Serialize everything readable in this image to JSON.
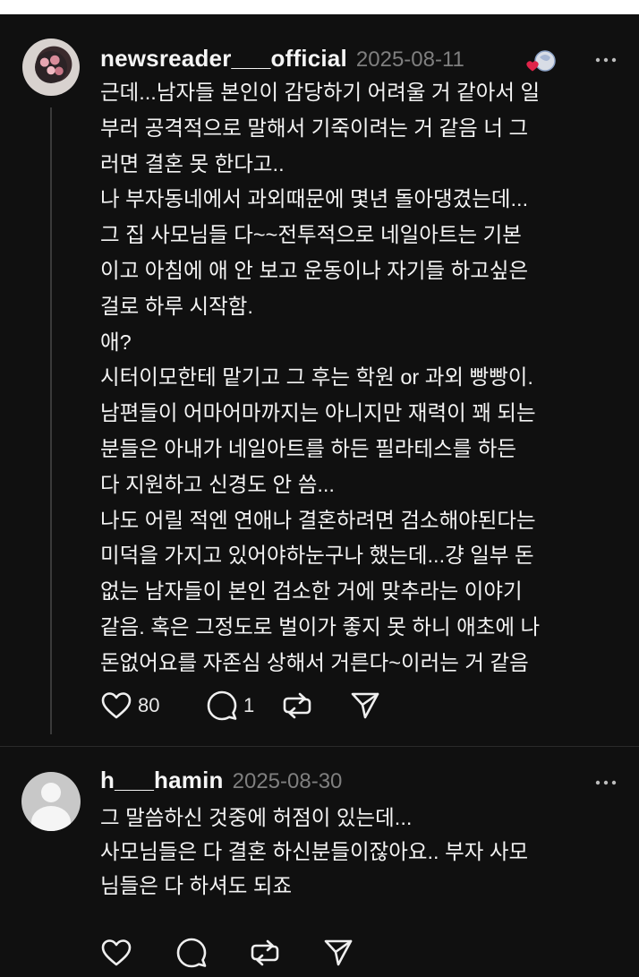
{
  "posts": [
    {
      "username": "newsreader___official",
      "date": "2025-08-11",
      "lines": [
        "근데...남자들 본인이 감당하기 어려울 거 같아서 일",
        "부러 공격적으로 말해서 기죽이려는 거 같음 너 그",
        "러면 결혼 못 한다고..",
        "나 부자동네에서 과외때문에 몇년 돌아댕겼는데...",
        "그 집 사모님들 다~~전투적으로 네일아트는 기본",
        "이고 아침에 애 안 보고 운동이나 자기들 하고싶은",
        "걸로 하루 시작함.",
        "애?",
        "시터이모한테 맡기고 그 후는 학원 or 과외 빵빵이.",
        "남편들이 어마어마까지는 아니지만 재력이 꽤 되는",
        "분들은 아내가 네일아트를 하든 필라테스를 하든",
        "다 지원하고 신경도 안 씀...",
        "나도 어릴 적엔 연애나 결혼하려면 검소해야된다는",
        "미덕을 가지고 있어야하눈구나 했는데...걍 일부 돈",
        "없는 남자들이 본인 검소한 거에 맞추라는 이야기",
        "같음. 혹은 그정도로 벌이가 좋지 못 하니 애초에 나",
        "돈없어요를 자존심 상해서 거른다~이러는 거 같음"
      ],
      "likes": "80",
      "replies": "1",
      "icons": {
        "badge": "heart-badge-icon",
        "more": "more-options-icon",
        "like": "heart-icon",
        "reply": "comment-icon",
        "repost": "repost-icon",
        "share": "share-icon"
      }
    },
    {
      "username": "h___hamin",
      "date": "2025-08-30",
      "lines": [
        "그 말씀하신 것중에 허점이 있는데...",
        "사모님들은 다 결혼 하신분들이잖아요.. 부자 사모",
        "님들은 다 하셔도 되죠"
      ],
      "likes": "",
      "replies": "",
      "icons": {
        "more": "more-options-icon",
        "like": "heart-icon",
        "reply": "comment-icon",
        "repost": "repost-icon",
        "share": "share-icon"
      }
    }
  ],
  "colors": {
    "background": "#101010",
    "text": "#f3f3f3",
    "muted": "#7f7f7f",
    "badge_heart": "#e0244a"
  }
}
